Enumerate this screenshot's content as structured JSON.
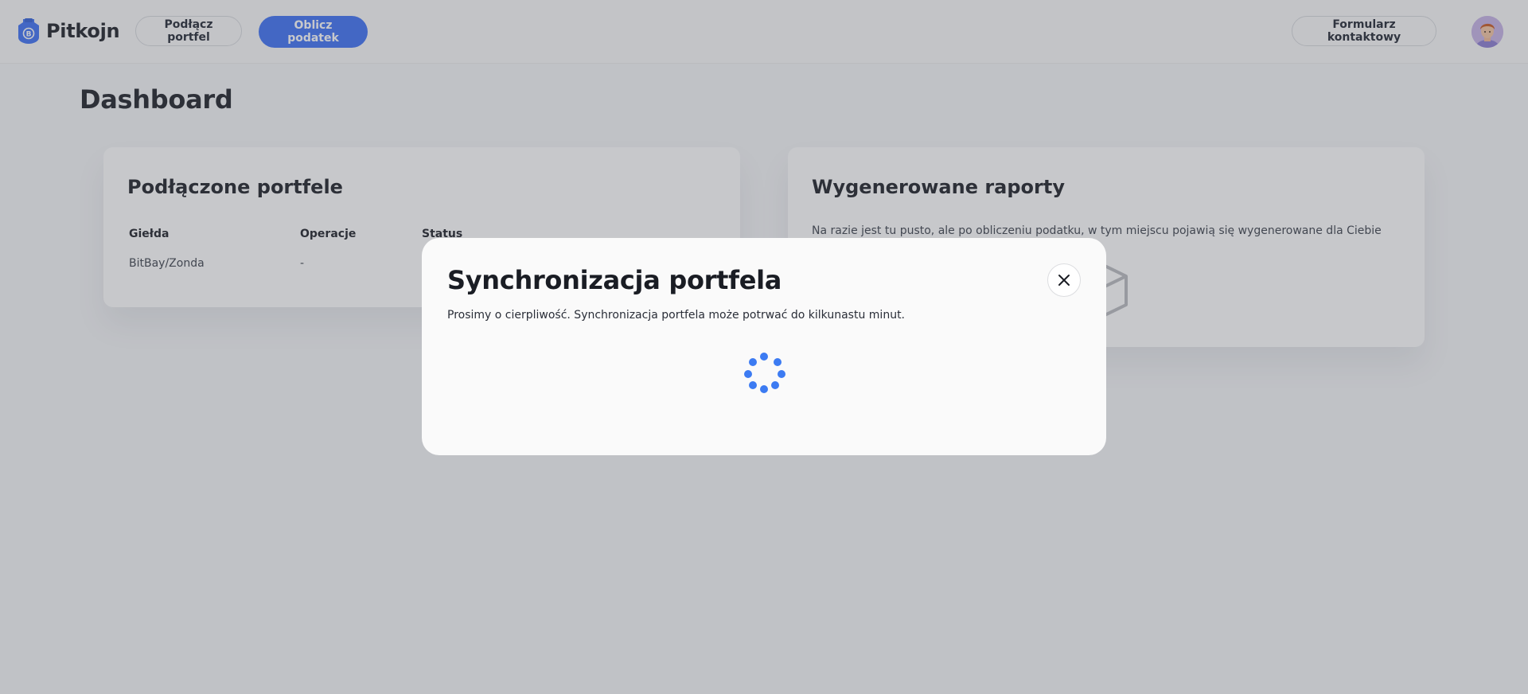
{
  "header": {
    "brand": "Pitkojn",
    "connect_wallet_label": "Podłącz portfel",
    "calculate_tax_label": "Oblicz podatek",
    "contact_form_label": "Formularz kontaktowy"
  },
  "page": {
    "title": "Dashboard"
  },
  "wallets_card": {
    "title": "Podłączone portfele",
    "columns": [
      "Giełda",
      "Operacje",
      "Status"
    ],
    "rows": [
      {
        "exchange": "BitBay/Zonda",
        "operations": "-",
        "status": ""
      }
    ]
  },
  "reports_card": {
    "title": "Wygenerowane raporty",
    "empty_text": "Na razie jest tu pusto, ale po obliczeniu podatku, w tym miejscu pojawią się wygenerowane dla Ciebie"
  },
  "modal": {
    "title": "Synchronizacja portfela",
    "description": "Prosimy o cierpliwość. Synchronizacja portfela może potrwać do kilkunastu minut.",
    "close_icon": "close-icon",
    "spinner_icon": "loading-spinner-icon"
  },
  "colors": {
    "primary": "#3b6ff5",
    "spinner": "#3c7bf2",
    "text": "#1a1d24",
    "card_bg": "#ffffff",
    "overlay": "rgba(85,89,97,0.33)"
  }
}
